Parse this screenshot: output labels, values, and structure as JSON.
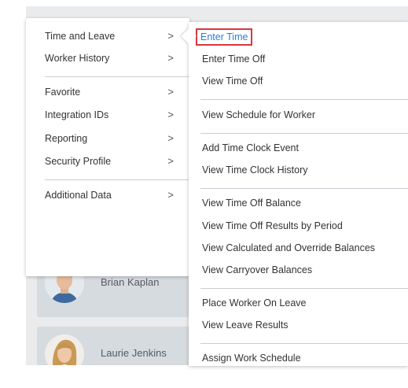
{
  "left_menu": {
    "items": [
      {
        "label": "Time and Leave",
        "chevron": ">"
      },
      {
        "label": "Worker History",
        "chevron": ">"
      },
      {
        "label": "Favorite",
        "chevron": ">"
      },
      {
        "label": "Integration IDs",
        "chevron": ">"
      },
      {
        "label": "Reporting",
        "chevron": ">"
      },
      {
        "label": "Security Profile",
        "chevron": ">"
      },
      {
        "label": "Additional Data",
        "chevron": ">"
      }
    ]
  },
  "submenu": {
    "items": [
      "Enter Time",
      "Enter Time Off",
      "View Time Off",
      "View Schedule for Worker",
      "Add Time Clock Event",
      "View Time Clock History",
      "View Time Off Balance",
      "View Time Off Results by Period",
      "View Calculated and Override Balances",
      "View Carryover Balances",
      "Place Worker On Leave",
      "View Leave Results",
      "Assign Work Schedule"
    ]
  },
  "workers": [
    {
      "name": "Brian Kaplan"
    },
    {
      "name": "Laurie Jenkins"
    }
  ],
  "colors": {
    "active_link": "#2a7fd6",
    "highlight_border": "#d9363e",
    "background_panel": "#e9ebed",
    "card": "#d6dbdf"
  }
}
